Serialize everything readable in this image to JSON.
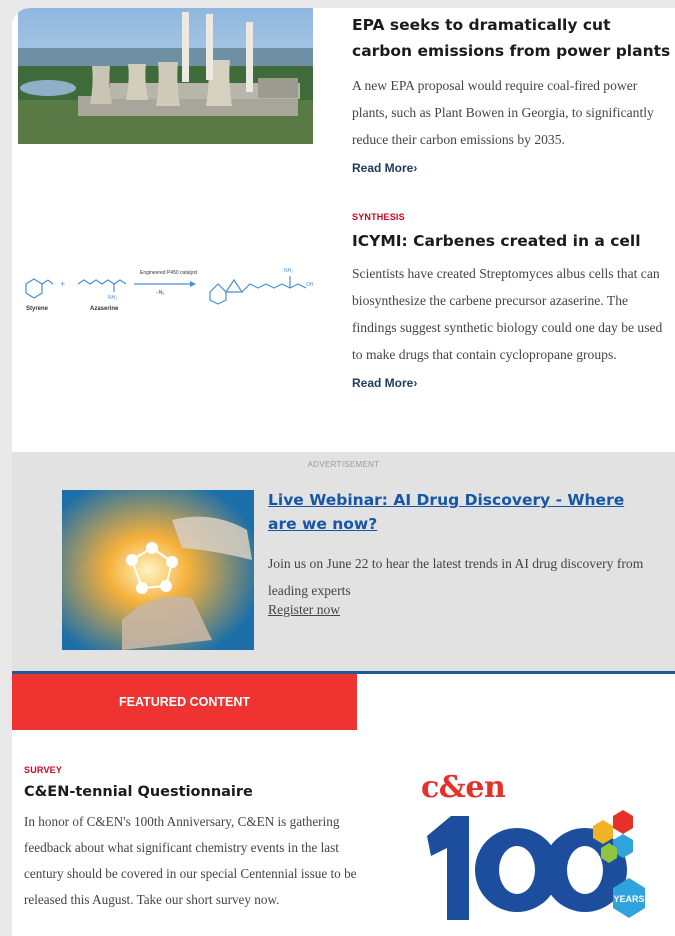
{
  "articles": [
    {
      "kicker": "",
      "title": "EPA seeks to dramatically cut carbon emissions from power plants",
      "summary": "A new EPA proposal would require coal-fired power plants, such as Plant Bowen in Georgia, to significantly reduce their carbon emissions by 2035.",
      "read_more": "Read More"
    },
    {
      "kicker": "SYNTHESIS",
      "title": "ICYMI: Carbenes created in a cell",
      "summary": "Scientists have created Streptomyces albus cells that can biosynthesize the carbene precursor azaserine. The findings suggest synthetic biology could one day be used to make drugs that contain cyclopropane groups.",
      "read_more": "Read More"
    }
  ],
  "scheme": {
    "styrene": "Styrene",
    "azaserine": "Azaserine",
    "catalyst": "Engineered P450 catalyst",
    "loss": "−N₂",
    "nh2": "NH₂",
    "oh": "OH"
  },
  "advertisement": {
    "label": "ADVERTISEMENT",
    "title": "Live Webinar: AI Drug Discovery - Where are we now?",
    "text": "Join us on June 22 to hear the latest trends in AI drug discovery from leading experts",
    "link": "Register now"
  },
  "featured": {
    "label": "FEATURED CONTENT",
    "kicker": "SURVEY",
    "title": "C&EN-tennial Questionnaire",
    "summary": "In honor of C&EN's 100th Anniversary, C&EN is gathering feedback about what significant chemistry events in the last century should be covered in our special Centennial issue to be released this August. Take our short survey now."
  },
  "logo": {
    "brand": "c&en",
    "years": "YEARS"
  },
  "colors": {
    "accent_red": "#ee3331",
    "link_blue": "#1656a6",
    "navy": "#1f5b96",
    "logo_blue": "#1d4e9e"
  }
}
